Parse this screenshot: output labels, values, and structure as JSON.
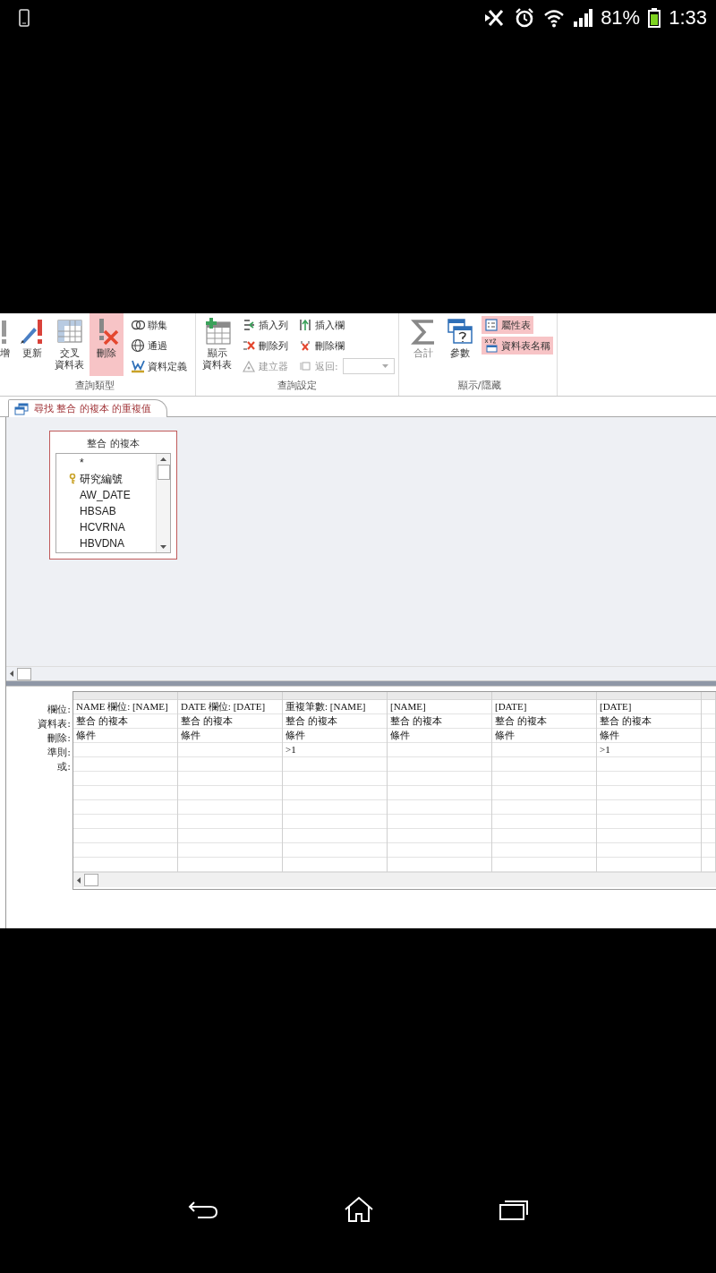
{
  "status_bar": {
    "battery": "81%",
    "time": "1:33"
  },
  "ribbon": {
    "groups": [
      {
        "label": "查詢類型",
        "items": [
          {
            "kind": "large",
            "lines": [
              "增"
            ],
            "selected": false,
            "disabled": false
          },
          {
            "kind": "large",
            "lines": [
              "更新"
            ],
            "selected": false,
            "disabled": false
          },
          {
            "kind": "large",
            "lines": [
              "交叉",
              "資料表"
            ],
            "selected": false,
            "disabled": false
          },
          {
            "kind": "large",
            "lines": [
              "刪除"
            ],
            "selected": true,
            "disabled": false
          },
          {
            "kind": "column",
            "items": [
              {
                "kind": "button",
                "label": "聯集",
                "selected": false,
                "disabled": false
              },
              {
                "kind": "button",
                "label": "通過",
                "selected": false,
                "disabled": false
              },
              {
                "kind": "button",
                "label": "資料定義",
                "selected": false,
                "disabled": false
              }
            ]
          }
        ]
      },
      {
        "label": "查詢設定",
        "items": [
          {
            "kind": "large",
            "lines": [
              "顯示",
              "資料表"
            ],
            "selected": false,
            "disabled": false
          },
          {
            "kind": "column",
            "items": [
              {
                "kind": "button",
                "label": "插入列",
                "selected": false,
                "disabled": false
              },
              {
                "kind": "button",
                "label": "刪除列",
                "selected": false,
                "disabled": false
              },
              {
                "kind": "button",
                "label": "建立器",
                "selected": false,
                "disabled": true
              }
            ]
          },
          {
            "kind": "column",
            "items": [
              {
                "kind": "button",
                "label": "插入欄",
                "selected": false,
                "disabled": false
              },
              {
                "kind": "button",
                "label": "刪除欄",
                "selected": false,
                "disabled": false
              },
              {
                "kind": "dropdown",
                "label": "返回:",
                "selected": false,
                "disabled": true
              }
            ]
          }
        ]
      },
      {
        "label": "顯示/隱藏",
        "items": [
          {
            "kind": "large",
            "lines": [
              "合計"
            ],
            "selected": false,
            "disabled": true
          },
          {
            "kind": "large",
            "lines": [
              "參數"
            ],
            "selected": false,
            "disabled": false
          },
          {
            "kind": "column",
            "items": [
              {
                "kind": "button",
                "label": "屬性表",
                "selected": true,
                "disabled": false
              },
              {
                "kind": "button",
                "label": "資料表名稱",
                "selected": true,
                "disabled": false
              }
            ]
          }
        ]
      }
    ]
  },
  "query_tab": {
    "title": "尋找 整合 的複本 的重複值",
    "selected": true
  },
  "field_list": {
    "title": "整合 的複本",
    "fields": [
      {
        "name": "*",
        "key": false
      },
      {
        "name": "研究編號",
        "key": true
      },
      {
        "name": "AW_DATE",
        "key": false
      },
      {
        "name": "HBSAB",
        "key": false
      },
      {
        "name": "HCVRNA",
        "key": false
      },
      {
        "name": "HBVDNA",
        "key": false
      }
    ]
  },
  "design_grid": {
    "row_labels": [
      "欄位:",
      "資料表:",
      "刪除:",
      "準則:",
      "或:"
    ],
    "columns": [
      {
        "field": "NAME 欄位: [NAME]",
        "table": "整合 的複本",
        "delete": "條件"
      },
      {
        "field": "DATE 欄位: [DATE]",
        "table": "整合 的複本",
        "delete": "條件"
      },
      {
        "field": "重複筆數: [NAME]",
        "table": "整合 的複本",
        "delete": "條件",
        "criteria": ">1"
      },
      {
        "field": "[NAME]",
        "table": "整合 的複本",
        "delete": "條件"
      },
      {
        "field": "[DATE]",
        "table": "整合 的複本",
        "delete": "條件"
      },
      {
        "field": "[DATE]",
        "table": "整合 的複本",
        "delete": "條件",
        "criteria": ">1"
      }
    ]
  }
}
